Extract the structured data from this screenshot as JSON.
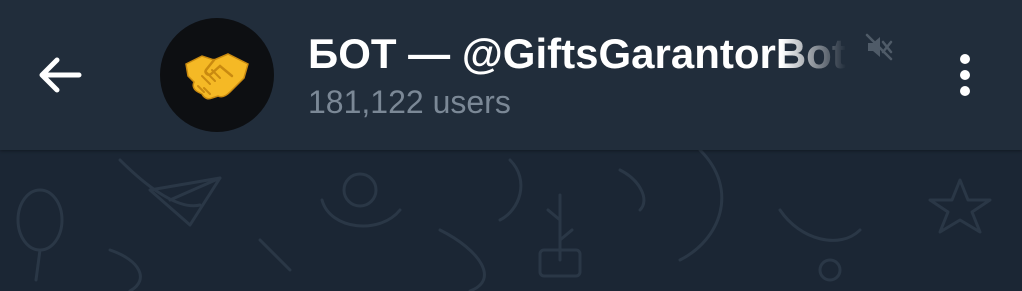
{
  "header": {
    "back_icon": "arrow-left-icon",
    "avatar_icon": "handshake-emoji",
    "title": "БОТ — @GiftsGarantorBot",
    "subtitle": "181,122 users",
    "mute_icon": "muted-speaker-icon",
    "menu_icon": "vertical-dots-icon"
  },
  "colors": {
    "header_bg": "#212d3b",
    "chat_bg": "#1b2634",
    "title": "#ffffff",
    "subtitle": "#7b8896"
  }
}
